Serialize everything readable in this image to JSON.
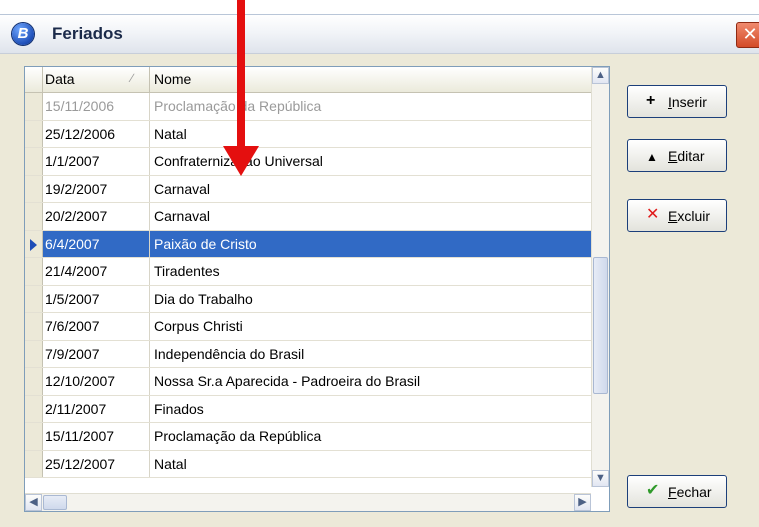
{
  "window": {
    "title": "Feriados",
    "app_icon": "B",
    "close_glyph": "✕"
  },
  "grid": {
    "columns": [
      "Data",
      "Nome"
    ],
    "rows": [
      {
        "date": "15/11/2006",
        "name": "Proclamação da República"
      },
      {
        "date": "25/12/2006",
        "name": "Natal"
      },
      {
        "date": "1/1/2007",
        "name": "Confraternização Universal"
      },
      {
        "date": "19/2/2007",
        "name": "Carnaval"
      },
      {
        "date": "20/2/2007",
        "name": "Carnaval"
      },
      {
        "date": "6/4/2007",
        "name": "Paixão de Cristo"
      },
      {
        "date": "21/4/2007",
        "name": "Tiradentes"
      },
      {
        "date": "1/5/2007",
        "name": "Dia do Trabalho"
      },
      {
        "date": "7/6/2007",
        "name": "Corpus Christi"
      },
      {
        "date": "7/9/2007",
        "name": "Independência do Brasil"
      },
      {
        "date": "12/10/2007",
        "name": "Nossa Sr.a Aparecida - Padroeira do Brasil"
      },
      {
        "date": "2/11/2007",
        "name": "Finados"
      },
      {
        "date": "15/11/2007",
        "name": "Proclamação da República"
      },
      {
        "date": "25/12/2007",
        "name": "Natal"
      }
    ],
    "selected_index": 5,
    "sort_glyph": "∕"
  },
  "buttons": {
    "inserir": "Inserir",
    "editar": "Editar",
    "excluir": "Excluir",
    "fechar": "Fechar"
  },
  "icons": {
    "inserir": "+",
    "editar": "▲",
    "excluir": "✕",
    "fechar": "✔"
  },
  "colors": {
    "selection": "#316ac5",
    "annotation_arrow": "#e40f0f",
    "excluir_icon": "#e01b1b",
    "fechar_icon": "#2f9a2a"
  }
}
